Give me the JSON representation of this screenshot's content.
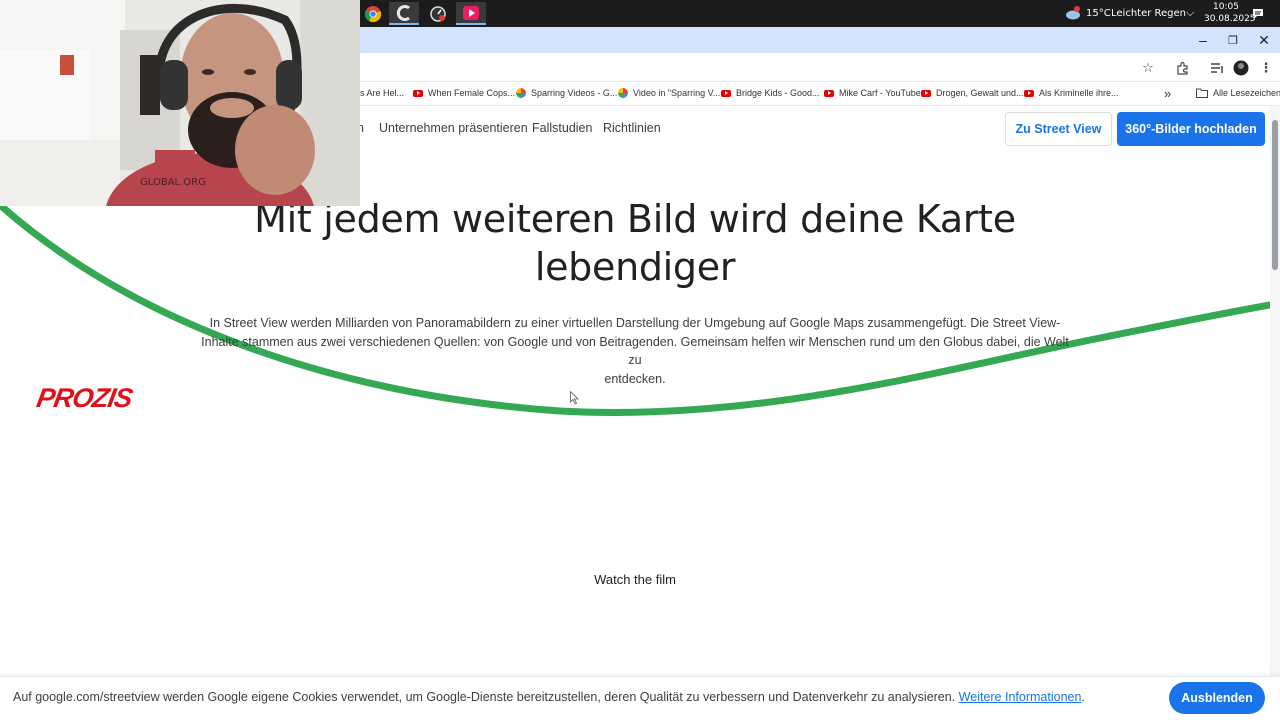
{
  "taskbar": {
    "apps": [
      "chrome-app",
      "ccleaner-app",
      "speedometer-app",
      "media-player-app"
    ],
    "weather": {
      "temp": "15°C",
      "condition": "Leichter Regen"
    },
    "clock": {
      "time": "10:05",
      "date": "30.08.2025"
    }
  },
  "bookmarks": {
    "items": [
      {
        "label": "s Are Hel...",
        "icon": "none"
      },
      {
        "label": "When Female Cops...",
        "icon": "youtube-icon"
      },
      {
        "label": "Sparring Videos - G...",
        "icon": "google-photos-icon"
      },
      {
        "label": "Video in \"Sparring V...",
        "icon": "google-photos-icon"
      },
      {
        "label": "Bridge Kids - Good...",
        "icon": "youtube-icon"
      },
      {
        "label": "Mike Carf - YouTube",
        "icon": "youtube-icon"
      },
      {
        "label": "Drogen, Gewalt und...",
        "icon": "youtube-icon"
      },
      {
        "label": "Als Kriminelle ihre...",
        "icon": "youtube-icon"
      }
    ],
    "more": "»",
    "all_bookmarks": "Alle Lesezeichen"
  },
  "nav": {
    "partial_first": "n",
    "links": [
      "Unternehmen präsentieren",
      "Fallstudien",
      "Richtlinien"
    ],
    "street_view_button": "Zu Street View",
    "upload_button": "360°-Bilder hochladen"
  },
  "main": {
    "headline_line1": "Mit jedem weiteren Bild wird deine Karte",
    "headline_line2": "lebendiger",
    "description_line1": "In Street View werden Milliarden von Panoramabildern zu einer virtuellen Darstellung der Umgebung auf Google Maps zusammengefügt. Die Street View-",
    "description_line2": "Inhalte stammen aus zwei verschiedenen Quellen: von Google und von Beitragenden. Gemeinsam helfen wir Menschen rund um den Globus dabei, die Welt zu",
    "description_line3": "entdecken.",
    "watch_film": "Watch the film"
  },
  "cookie": {
    "text": "Auf google.com/streetview werden Google eigene Cookies verwendet, um Google-Dienste bereitzustellen, deren Qualität zu verbessern und Datenverkehr zu analysieren.",
    "link": "Weitere Informationen",
    "period": ".",
    "button": "Ausblenden"
  },
  "overlay": {
    "sponsor_logo": "PROZIS",
    "shirt_text": "GLOBAL ORG"
  },
  "colors": {
    "accent_blue": "#1a73e8",
    "green_swoosh": "#34a853",
    "prozis_red": "#e0101a",
    "taskbar": "#1c1c1c",
    "titlebar": "#d3e3fd"
  }
}
